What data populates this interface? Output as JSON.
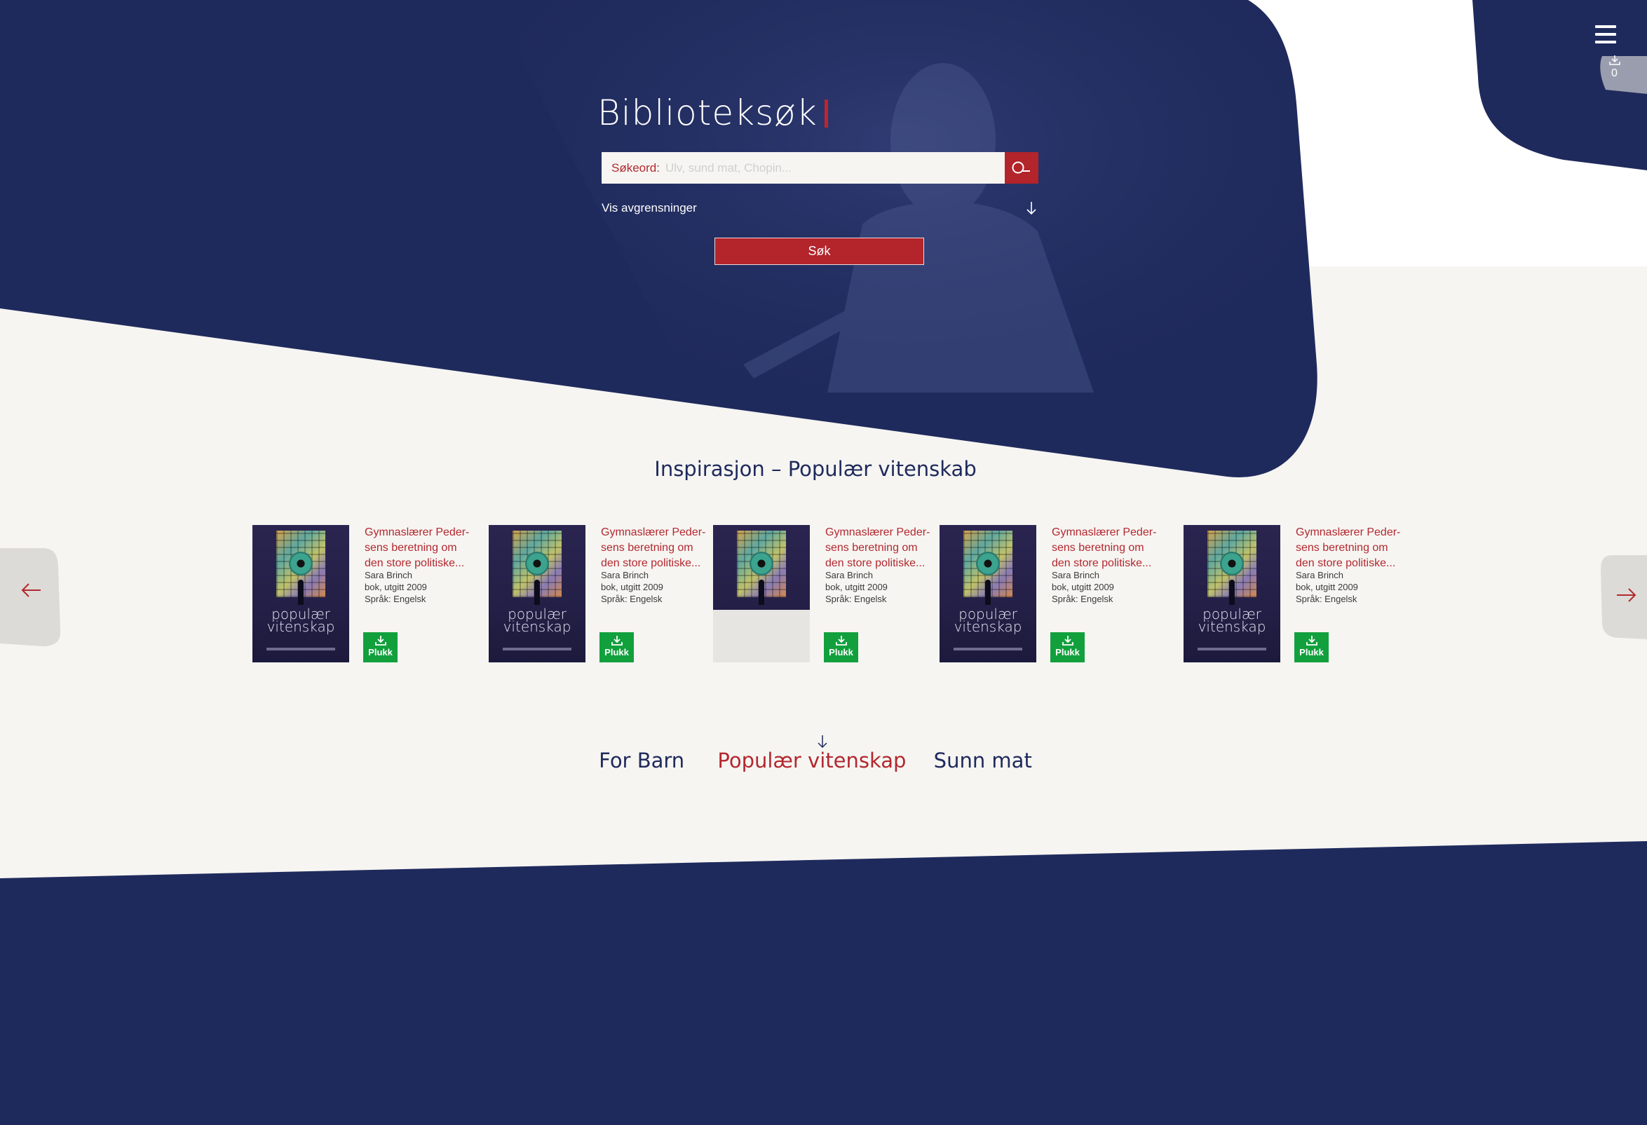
{
  "colors": {
    "navy": "#1f2a5c",
    "accent_red": "#b3242b",
    "plukk_green": "#12a03d",
    "background": "#f6f5f2"
  },
  "search": {
    "title": "Biblioteksøk",
    "label": "Søkeord:",
    "placeholder": "Ulv, sund mat, Chopin...",
    "filters_label": "Vis avgrensninger",
    "submit_label": "Søk",
    "search_icon": "magnifier-icon",
    "filters_icon": "arrow-down-icon"
  },
  "top_right": {
    "menu_icon": "hamburger-icon",
    "download_icon": "download-icon",
    "download_count": "0"
  },
  "inspiration": {
    "heading": "Inspirasjon – Populær vitenskab",
    "books": [
      {
        "title": "Gymnaslærer Peder-sens beretning om den store politiske...",
        "author": "Sara Brinch",
        "type": "bok, utgitt 2009",
        "language": "Språk: Engelsk",
        "cover_title": "populær vitenskap",
        "cover_partial": false,
        "pick_label": "Plukk"
      },
      {
        "title": "Gymnaslærer Peder-sens beretning om den store politiske...",
        "author": "Sara Brinch",
        "type": "bok, utgitt 2009",
        "language": "Språk: Engelsk",
        "cover_title": "populær vitenskap",
        "cover_partial": false,
        "pick_label": "Plukk"
      },
      {
        "title": "Gymnaslærer Peder-sens beretning om den store politiske...",
        "author": "Sara Brinch",
        "type": "bok, utgitt 2009",
        "language": "Språk: Engelsk",
        "cover_title": "",
        "cover_partial": true,
        "pick_label": "Plukk"
      },
      {
        "title": "Gymnaslærer Peder-sens beretning om den store politiske...",
        "author": "Sara Brinch",
        "type": "bok, utgitt 2009",
        "language": "Språk: Engelsk",
        "cover_title": "populær vitenskap",
        "cover_partial": false,
        "pick_label": "Plukk"
      },
      {
        "title": "Gymnaslærer Peder-sens beretning om den store politiske...",
        "author": "Sara Brinch",
        "type": "bok, utgitt 2009",
        "language": "Språk: Engelsk",
        "cover_title": "populær vitenskap",
        "cover_partial": false,
        "pick_label": "Plukk"
      }
    ],
    "prev_icon": "arrow-left-icon",
    "next_icon": "arrow-right-icon"
  },
  "categories": {
    "indicator_icon": "arrow-down-icon",
    "tabs": [
      {
        "label": "For Barn",
        "active": false
      },
      {
        "label": "Populær vitenskap",
        "active": true
      },
      {
        "label": "Sunn mat",
        "active": false
      }
    ]
  }
}
